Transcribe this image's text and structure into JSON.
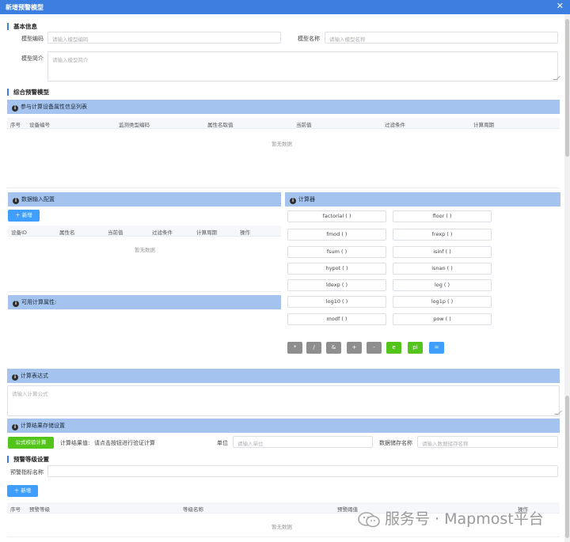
{
  "dialog": {
    "title": "新增预警模型",
    "close_icon": "close-icon"
  },
  "basic": {
    "section_title": "基本信息",
    "code_label": "模型编码",
    "code_placeholder": "请输入模型编码",
    "name_label": "模型名称",
    "name_placeholder": "请输入模型名称",
    "desc_label": "模型简介",
    "desc_placeholder": "请输入模型简介"
  },
  "composite": {
    "section_title": "综合预警模型",
    "device_bar": "参与计算设备属性信息列表",
    "device_columns": [
      "序号",
      "设备编号",
      "监测类型编码",
      "属性名取值",
      "当前值",
      "过滤条件",
      "计算周期"
    ],
    "device_empty": "暂无数据"
  },
  "input_config": {
    "bar": "数据输入配置",
    "add_label": "新增",
    "columns": [
      "设备ID",
      "属性名",
      "当前值",
      "过滤条件",
      "计算周期",
      "操作"
    ],
    "empty": "暂无数据",
    "available_bar": "可用计算属性:"
  },
  "calculator": {
    "bar": "计算器",
    "functions": [
      [
        "factorial ( )",
        "floor ( )"
      ],
      [
        "fmod ( )",
        "frexp ( )"
      ],
      [
        "fsum ( )",
        "isinf ( )"
      ],
      [
        "hypot ( )",
        "isnan ( )"
      ],
      [
        "ldexp ( )",
        "log ( )"
      ],
      [
        "log10 ( )",
        "log1p ( )"
      ],
      [
        "modf ( )",
        "pow ( )"
      ]
    ],
    "operators": [
      "*",
      "/",
      "&",
      "+",
      "-",
      "e",
      "pi",
      "="
    ]
  },
  "expression": {
    "bar": "计算表达式",
    "placeholder": "请输入计算公式"
  },
  "storage": {
    "bar": "计算结果存储设置",
    "verify_label": "公式校验计算",
    "result_label": "计算结果值:",
    "result_value": "请点击按钮进行验证计算",
    "unit_label": "单位",
    "unit_placeholder": "请输入单位",
    "store_label": "数据储存名称",
    "store_placeholder": "请输入数据储存名称"
  },
  "levels": {
    "section_title": "预警等级设置",
    "indicator_label": "预警指标名称",
    "add_label": "新增",
    "columns": [
      "序号",
      "预警等级",
      "等级名称",
      "预警阈值",
      "操作"
    ],
    "empty": "暂无数据"
  },
  "watermark": {
    "text": "服务号 · Mapmost平台"
  },
  "colors": {
    "header": "#3d7fe0",
    "panel_bar": "#a4c3ee",
    "primary": "#409eff",
    "success": "#52c41a",
    "operator": "#8e8e8e"
  }
}
